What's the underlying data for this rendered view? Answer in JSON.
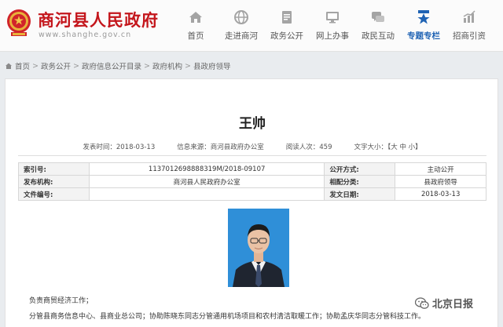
{
  "header": {
    "site_name": "商河县人民政府",
    "site_domain": "www.shanghe.gov.cn",
    "nav": [
      {
        "label": "首页",
        "icon": "home-icon"
      },
      {
        "label": "走进商河",
        "icon": "globe-icon"
      },
      {
        "label": "政务公开",
        "icon": "document-icon"
      },
      {
        "label": "网上办事",
        "icon": "monitor-icon"
      },
      {
        "label": "政民互动",
        "icon": "chat-icon"
      },
      {
        "label": "专题专栏",
        "icon": "star-icon",
        "active": true
      },
      {
        "label": "招商引资",
        "icon": "bar-chart-icon"
      }
    ]
  },
  "breadcrumb": [
    "首页",
    "政务公开",
    "政府信息公开目录",
    "政府机构",
    "县政府领导"
  ],
  "article": {
    "title": "王帅",
    "meta": {
      "publish_time": "发表时间：2018-03-13",
      "source": "信息来源：商河县政府办公室",
      "views": "阅读人次：459",
      "font_size": "文字大小：【大  中  小】"
    },
    "info_table": [
      {
        "l1": "索引号:",
        "v1": "1137012698888319M/2018-09107",
        "l2": "公开方式:",
        "v2": "主动公开"
      },
      {
        "l1": "发布机构:",
        "v1": "商河县人民政府办公室",
        "l2": "相配分类:",
        "v2": "县政府领导"
      },
      {
        "l1": "文件编号:",
        "v1": "",
        "l2": "发文日期:",
        "v2": "2018-03-13"
      }
    ],
    "desc_line1": "负责商贸经济工作；",
    "desc_line2": "分管县商务信息中心、县商业总公司；协助陈晓东同志分管通用机场项目和农村清洁取暖工作；协助孟庆华同志分管科技工作。"
  },
  "watermark": "北京日报",
  "colors": {
    "brand_red": "#c4161c",
    "accent_blue": "#1f63b4",
    "photo_bg": "#2f8fd8"
  }
}
